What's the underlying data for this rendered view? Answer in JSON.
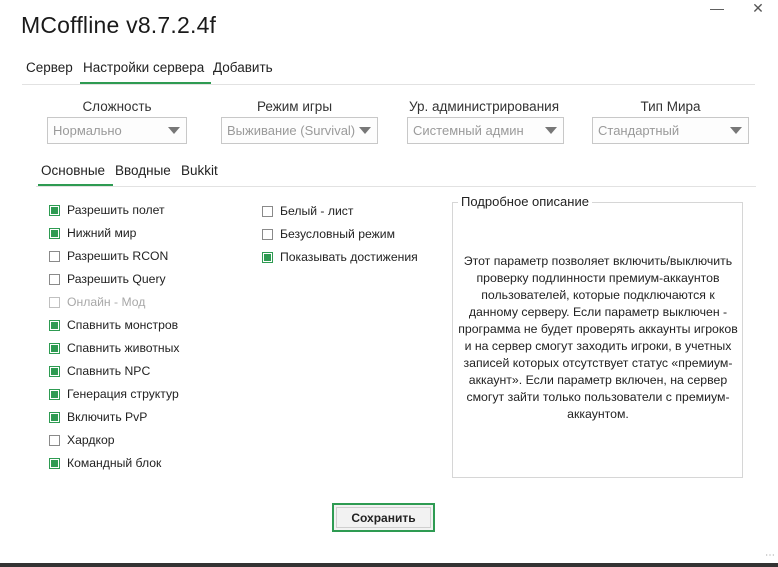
{
  "app": {
    "title": "MCoffline v8.7.2.4f"
  },
  "window": {
    "minimize_icon": "minimize-icon",
    "close_icon": "close-icon"
  },
  "top_tabs": [
    {
      "label": "Сервер",
      "active": false
    },
    {
      "label": "Настройки сервера",
      "active": true
    },
    {
      "label": "Добавить",
      "active": false
    }
  ],
  "dropdowns": [
    {
      "label": "Сложность",
      "value": "Нормально"
    },
    {
      "label": "Режим игры",
      "value": "Выживание (Survival)"
    },
    {
      "label": "Ур. администрирования",
      "value": "Системный админ"
    },
    {
      "label": "Тип Мира",
      "value": "Стандартный"
    }
  ],
  "sub_tabs": [
    {
      "label": "Основные",
      "active": true
    },
    {
      "label": "Вводные",
      "active": false
    },
    {
      "label": "Bukkit",
      "active": false
    }
  ],
  "options_left": [
    {
      "label": "Разрешить полет",
      "checked": true,
      "enabled": true
    },
    {
      "label": "Нижний мир",
      "checked": true,
      "enabled": true
    },
    {
      "label": "Разрешить RCON",
      "checked": false,
      "enabled": true
    },
    {
      "label": "Разрешить Query",
      "checked": false,
      "enabled": true
    },
    {
      "label": "Онлайн - Мод",
      "checked": false,
      "enabled": false
    },
    {
      "label": "Спавнить монстров",
      "checked": true,
      "enabled": true
    },
    {
      "label": "Спавнить животных",
      "checked": true,
      "enabled": true
    },
    {
      "label": "Спавнить NPC",
      "checked": true,
      "enabled": true
    },
    {
      "label": "Генерация структур",
      "checked": true,
      "enabled": true
    },
    {
      "label": "Включить PvP",
      "checked": true,
      "enabled": true
    },
    {
      "label": "Хардкор",
      "checked": false,
      "enabled": true
    },
    {
      "label": "Командный блок",
      "checked": true,
      "enabled": true
    }
  ],
  "options_right": [
    {
      "label": "Белый - лист",
      "checked": false,
      "enabled": true
    },
    {
      "label": "Безусловный режим",
      "checked": false,
      "enabled": true
    },
    {
      "label": "Показывать достижения",
      "checked": true,
      "enabled": true
    }
  ],
  "description": {
    "title": "Подробное описание",
    "text": "Этот параметр позволяет включить/выключить проверку подлинности премиум-аккаунтов пользователей, которые подключаются к данному серверу. Если параметр выключен - программа не будет проверять аккаунты игроков и на сервер смогут заходить игроки, в учетных записей которых отсутствует статус «премиум-аккаунт». Если параметр включен, на сервер смогут зайти только пользователи с премиум-аккаунтом."
  },
  "save_button": {
    "label": "Сохранить"
  },
  "colors": {
    "accent": "#2e9b52",
    "separator": "#e2e2e2",
    "muted_text": "#9a9a9a"
  }
}
